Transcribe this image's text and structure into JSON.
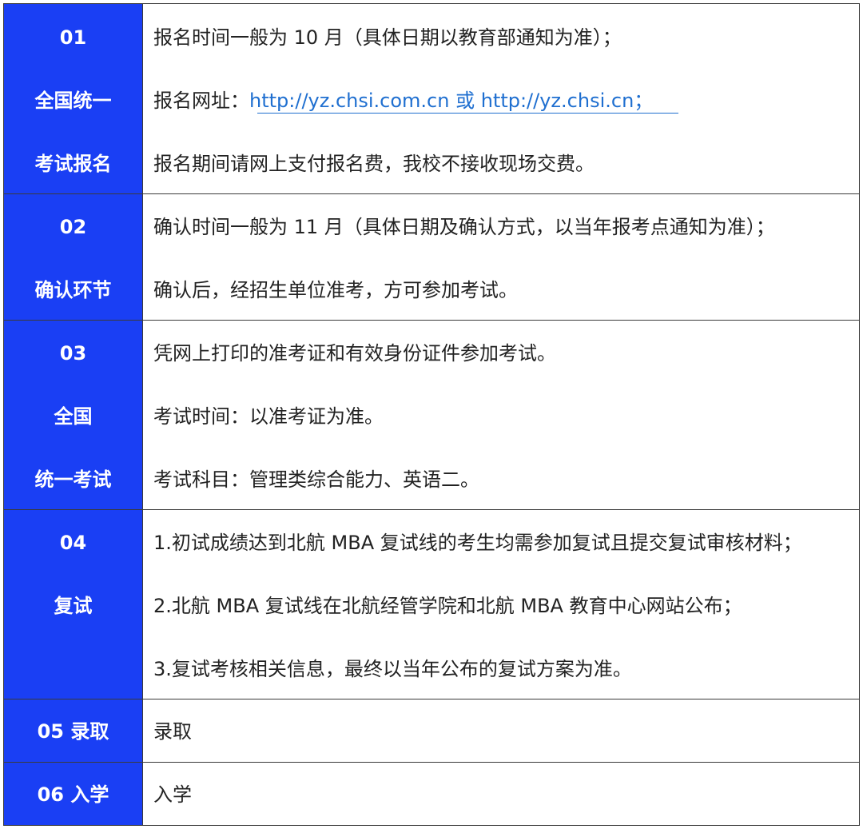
{
  "rows": [
    {
      "label_lines": [
        "01",
        "全国统一",
        "考试报名"
      ],
      "content_lines": [
        {
          "text": "报名时间一般为 10 月（具体日期以教育部通知为准）；"
        },
        {
          "prefix": "报名网址：",
          "link": "http://yz.chsi.com.cn 或 http://yz.chsi.cn；"
        },
        {
          "text": "报名期间请网上支付报名费，我校不接收现场交费。"
        }
      ]
    },
    {
      "label_lines": [
        "02",
        "确认环节"
      ],
      "content_lines": [
        {
          "text": "确认时间一般为 11 月（具体日期及确认方式，以当年报考点通知为准）；"
        },
        {
          "text": "确认后，经招生单位准考，方可参加考试。"
        }
      ]
    },
    {
      "label_lines": [
        "03",
        "全国",
        "统一考试"
      ],
      "content_lines": [
        {
          "text": "凭网上打印的准考证和有效身份证件参加考试。"
        },
        {
          "text": "考试时间：以准考证为准。"
        },
        {
          "text": "考试科目：管理类综合能力、英语二。"
        }
      ]
    },
    {
      "label_lines": [
        "04",
        "复试"
      ],
      "content_lines": [
        {
          "text": "1.初试成绩达到北航 MBA 复试线的考生均需参加复试且提交复试审核材料；"
        },
        {
          "text": "2.北航 MBA 复试线在北航经管学院和北航 MBA 教育中心网站公布；"
        },
        {
          "text": "3.复试考核相关信息，最终以当年公布的复试方案为准。"
        }
      ]
    },
    {
      "label_lines": [
        "05 录取"
      ],
      "content_lines": [
        {
          "text": "录取"
        }
      ]
    },
    {
      "label_lines": [
        "06 入学"
      ],
      "content_lines": [
        {
          "text": "入学"
        }
      ]
    }
  ],
  "colors": {
    "label_background": "#1a3ff4",
    "label_text": "#ffffff",
    "content_text": "#222222",
    "link": "#1f6fd0",
    "border": "#3a3a3a"
  }
}
